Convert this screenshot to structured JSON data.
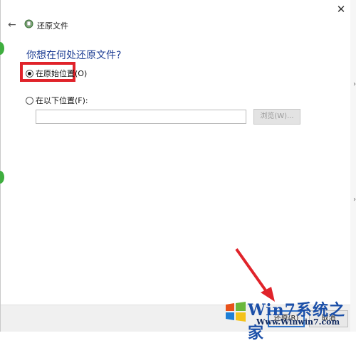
{
  "window": {
    "title": "还原文件",
    "close_glyph": "✕",
    "back_glyph": "←"
  },
  "main": {
    "heading": "你想在何处还原文件?",
    "options": [
      {
        "label": "在原始位置(O)",
        "selected": true
      },
      {
        "label": "在以下位置(F):",
        "selected": false
      }
    ],
    "path_input": {
      "value": "",
      "placeholder": ""
    },
    "browse_label": "浏览(W)..."
  },
  "footer": {
    "restore_label": "还原(R)",
    "cancel_label": "取消"
  },
  "watermark": {
    "brand": "Win7系统之家",
    "url": "Www.Winwin7.com"
  },
  "colors": {
    "accent": "#1f3f95",
    "highlight": "#e0232a"
  }
}
